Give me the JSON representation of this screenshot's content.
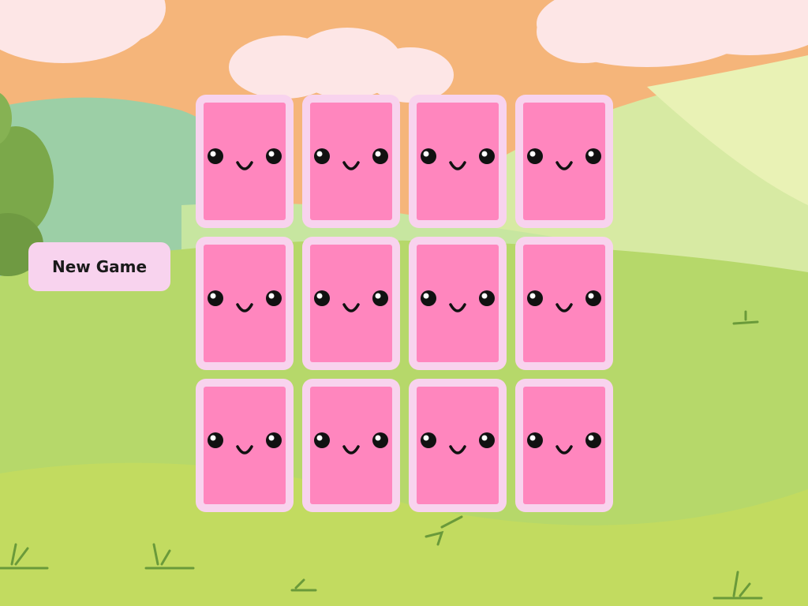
{
  "controls": {
    "new_game_label": "New Game"
  },
  "board": {
    "rows": 3,
    "columns": 4,
    "cards": [
      {
        "state": "face-down"
      },
      {
        "state": "face-down"
      },
      {
        "state": "face-down"
      },
      {
        "state": "face-down"
      },
      {
        "state": "face-down"
      },
      {
        "state": "face-down"
      },
      {
        "state": "face-down"
      },
      {
        "state": "face-down"
      },
      {
        "state": "face-down"
      },
      {
        "state": "face-down"
      },
      {
        "state": "face-down"
      },
      {
        "state": "face-down"
      }
    ],
    "card_back_icon": "kawaii-face-icon"
  },
  "colors": {
    "card_border": "#f8d3ee",
    "card_back": "#ff86be",
    "button_bg": "#f8d3ee",
    "sky": "#f5b87a",
    "hills": "#b6d86a"
  }
}
